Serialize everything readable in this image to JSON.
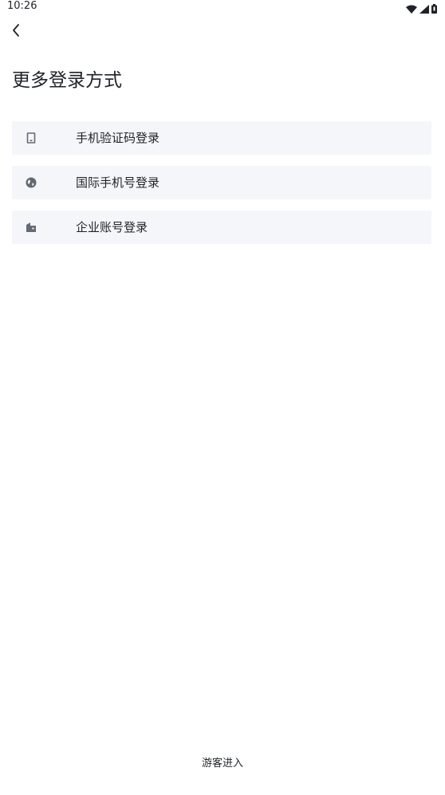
{
  "status_bar": {
    "time": "10:26",
    "icons": [
      "wifi-icon",
      "signal-icon",
      "battery-icon"
    ]
  },
  "header": {
    "back_icon": "chevron-left-icon"
  },
  "page": {
    "title": "更多登录方式"
  },
  "login_options": [
    {
      "icon": "phone-icon",
      "label": "手机验证码登录"
    },
    {
      "icon": "globe-icon",
      "label": "国际手机号登录"
    },
    {
      "icon": "building-icon",
      "label": "企业账号登录"
    }
  ],
  "footer": {
    "guest_label": "游客进入"
  },
  "colors": {
    "text": "#1f2329",
    "option_background": "#f5f6fa",
    "icon": "#646a73"
  }
}
